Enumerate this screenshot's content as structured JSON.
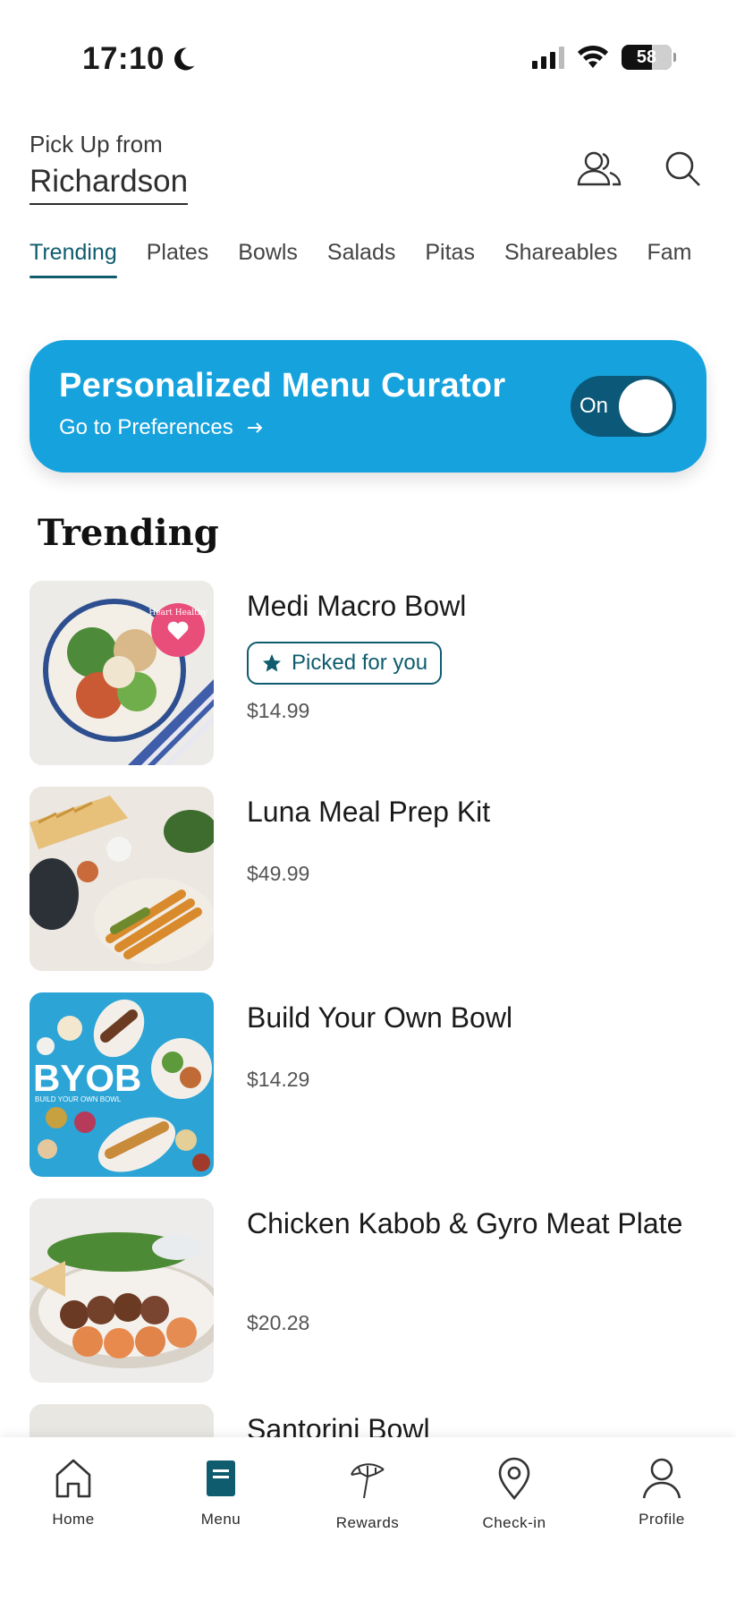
{
  "status_bar": {
    "time": "17:10",
    "battery": "58"
  },
  "header": {
    "pickup_label": "Pick Up from",
    "store": "Richardson",
    "icons": [
      "group-icon",
      "search-icon"
    ]
  },
  "tabs": [
    {
      "label": "Trending",
      "active": true
    },
    {
      "label": "Plates",
      "active": false
    },
    {
      "label": "Bowls",
      "active": false
    },
    {
      "label": "Salads",
      "active": false
    },
    {
      "label": "Pitas",
      "active": false
    },
    {
      "label": "Shareables",
      "active": false
    },
    {
      "label": "Fam",
      "active": false
    }
  ],
  "banner": {
    "title": "Personalized Menu Curator",
    "link": "Go to Preferences",
    "toggle_label": "On",
    "color": "#16a2dd"
  },
  "section": {
    "title": "Trending"
  },
  "items": [
    {
      "name": "Medi Macro Bowl",
      "badge": "Picked for you",
      "price": "$14.99",
      "image": "medi-macro-bowl-photo",
      "thumb_text": "Heart Healthy"
    },
    {
      "name": "Luna Meal Prep Kit",
      "price": "$49.99",
      "image": "luna-meal-prep-kit-photo"
    },
    {
      "name": "Build Your Own Bowl",
      "price": "$14.29",
      "image": "build-your-own-bowl-photo",
      "thumb_text": "BYOB",
      "thumb_subtext": "BUILD YOUR OWN BOWL"
    },
    {
      "name": "Chicken Kabob & Gyro Meat Plate",
      "price": "$20.28",
      "image": "chicken-kabob-gyro-plate-photo"
    },
    {
      "name": "Santorini Bowl",
      "image": "santorini-bowl-photo"
    }
  ],
  "bottom_nav": [
    {
      "label": "Home",
      "icon": "home-icon"
    },
    {
      "label": "Menu",
      "icon": "menu-book-icon",
      "active": true
    },
    {
      "label": "Rewards",
      "icon": "umbrella-icon"
    },
    {
      "label": "Check-in",
      "icon": "location-pin-icon"
    },
    {
      "label": "Profile",
      "icon": "person-icon"
    }
  ],
  "colors": {
    "accent": "#0e5c6e",
    "banner": "#16a2dd",
    "toggle": "#0c5878"
  }
}
